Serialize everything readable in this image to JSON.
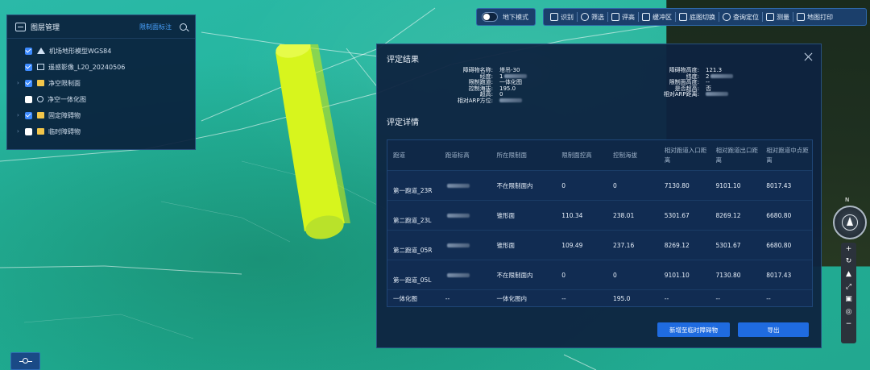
{
  "toolbar": {
    "underground_label": "地下模式",
    "items": [
      {
        "label": "识别",
        "icon": "layers-icon"
      },
      {
        "label": "筛选",
        "icon": "search-icon"
      },
      {
        "label": "评高",
        "icon": "height-icon"
      },
      {
        "label": "缓冲区",
        "icon": "buffer-icon"
      },
      {
        "label": "底图切换",
        "icon": "basemap-icon"
      },
      {
        "label": "查询定位",
        "icon": "locate-icon"
      },
      {
        "label": "测量",
        "icon": "measure-icon"
      },
      {
        "label": "地图打印",
        "icon": "print-icon"
      }
    ]
  },
  "layer_panel": {
    "title": "图层管理",
    "link": "限制面标注",
    "items": [
      {
        "label": "机场地形模型WGS84",
        "checked": true,
        "expandable": false,
        "icon": "terrain-icon"
      },
      {
        "label": "遥感影像_L20_20240506",
        "checked": true,
        "expandable": false,
        "icon": "image-icon"
      },
      {
        "label": "净空限制面",
        "checked": true,
        "expandable": true,
        "icon": "folder-icon"
      },
      {
        "label": "净空一体化图",
        "checked": false,
        "expandable": false,
        "icon": "group-icon"
      },
      {
        "label": "固定障碍物",
        "checked": true,
        "expandable": true,
        "icon": "folder-icon"
      },
      {
        "label": "临时障碍物",
        "checked": false,
        "expandable": true,
        "icon": "folder-icon"
      }
    ]
  },
  "dialog": {
    "title": "评定结果",
    "details_title": "评定详情",
    "info_left": [
      {
        "label": "障碍物名称:",
        "value": "塔吊-30"
      },
      {
        "label": "经度:",
        "value": "1"
      },
      {
        "label": "限制跑道:",
        "value": "一体化图"
      },
      {
        "label": "控制海拔:",
        "value": "195.0"
      },
      {
        "label": "超高:",
        "value": "0"
      },
      {
        "label": "相对ARP方位:",
        "value": ""
      }
    ],
    "info_right": [
      {
        "label": "障碍物高度:",
        "value": "121.3"
      },
      {
        "label": "纬度:",
        "value": "2"
      },
      {
        "label": "限制面高度:",
        "value": "--"
      },
      {
        "label": "是否超高:",
        "value": "否"
      },
      {
        "label": "相对ARP距离:",
        "value": ""
      }
    ],
    "table": {
      "headers": [
        "跑道",
        "跑道标高",
        "所在限制面",
        "限制面控高",
        "控制海拔",
        "相对跑道入口距离",
        "相对跑道出口距离",
        "相对跑道中点距离"
      ],
      "rows": [
        [
          "第一跑道_23R",
          "",
          "不在限制面内",
          "0",
          "0",
          "7130.80",
          "9101.10",
          "8017.43"
        ],
        [
          "第二跑道_23L",
          "",
          "锥形面",
          "110.34",
          "238.01",
          "5301.67",
          "8269.12",
          "6680.80"
        ],
        [
          "第二跑道_05R",
          "",
          "锥形面",
          "109.49",
          "237.16",
          "8269.12",
          "5301.67",
          "6680.80"
        ],
        [
          "第一跑道_05L",
          "",
          "不在限制面内",
          "0",
          "0",
          "9101.10",
          "7130.80",
          "8017.43"
        ],
        [
          "一体化图",
          "--",
          "一体化图内",
          "--",
          "195.0",
          "--",
          "--",
          "--"
        ]
      ]
    },
    "buttons": {
      "add_temp": "新增至临时障碍物",
      "export": "导出"
    }
  },
  "compass": {
    "north_label": "N"
  },
  "map_tools": [
    "+",
    "↻",
    "▲",
    "⤢",
    "▣",
    "◎",
    "−"
  ]
}
